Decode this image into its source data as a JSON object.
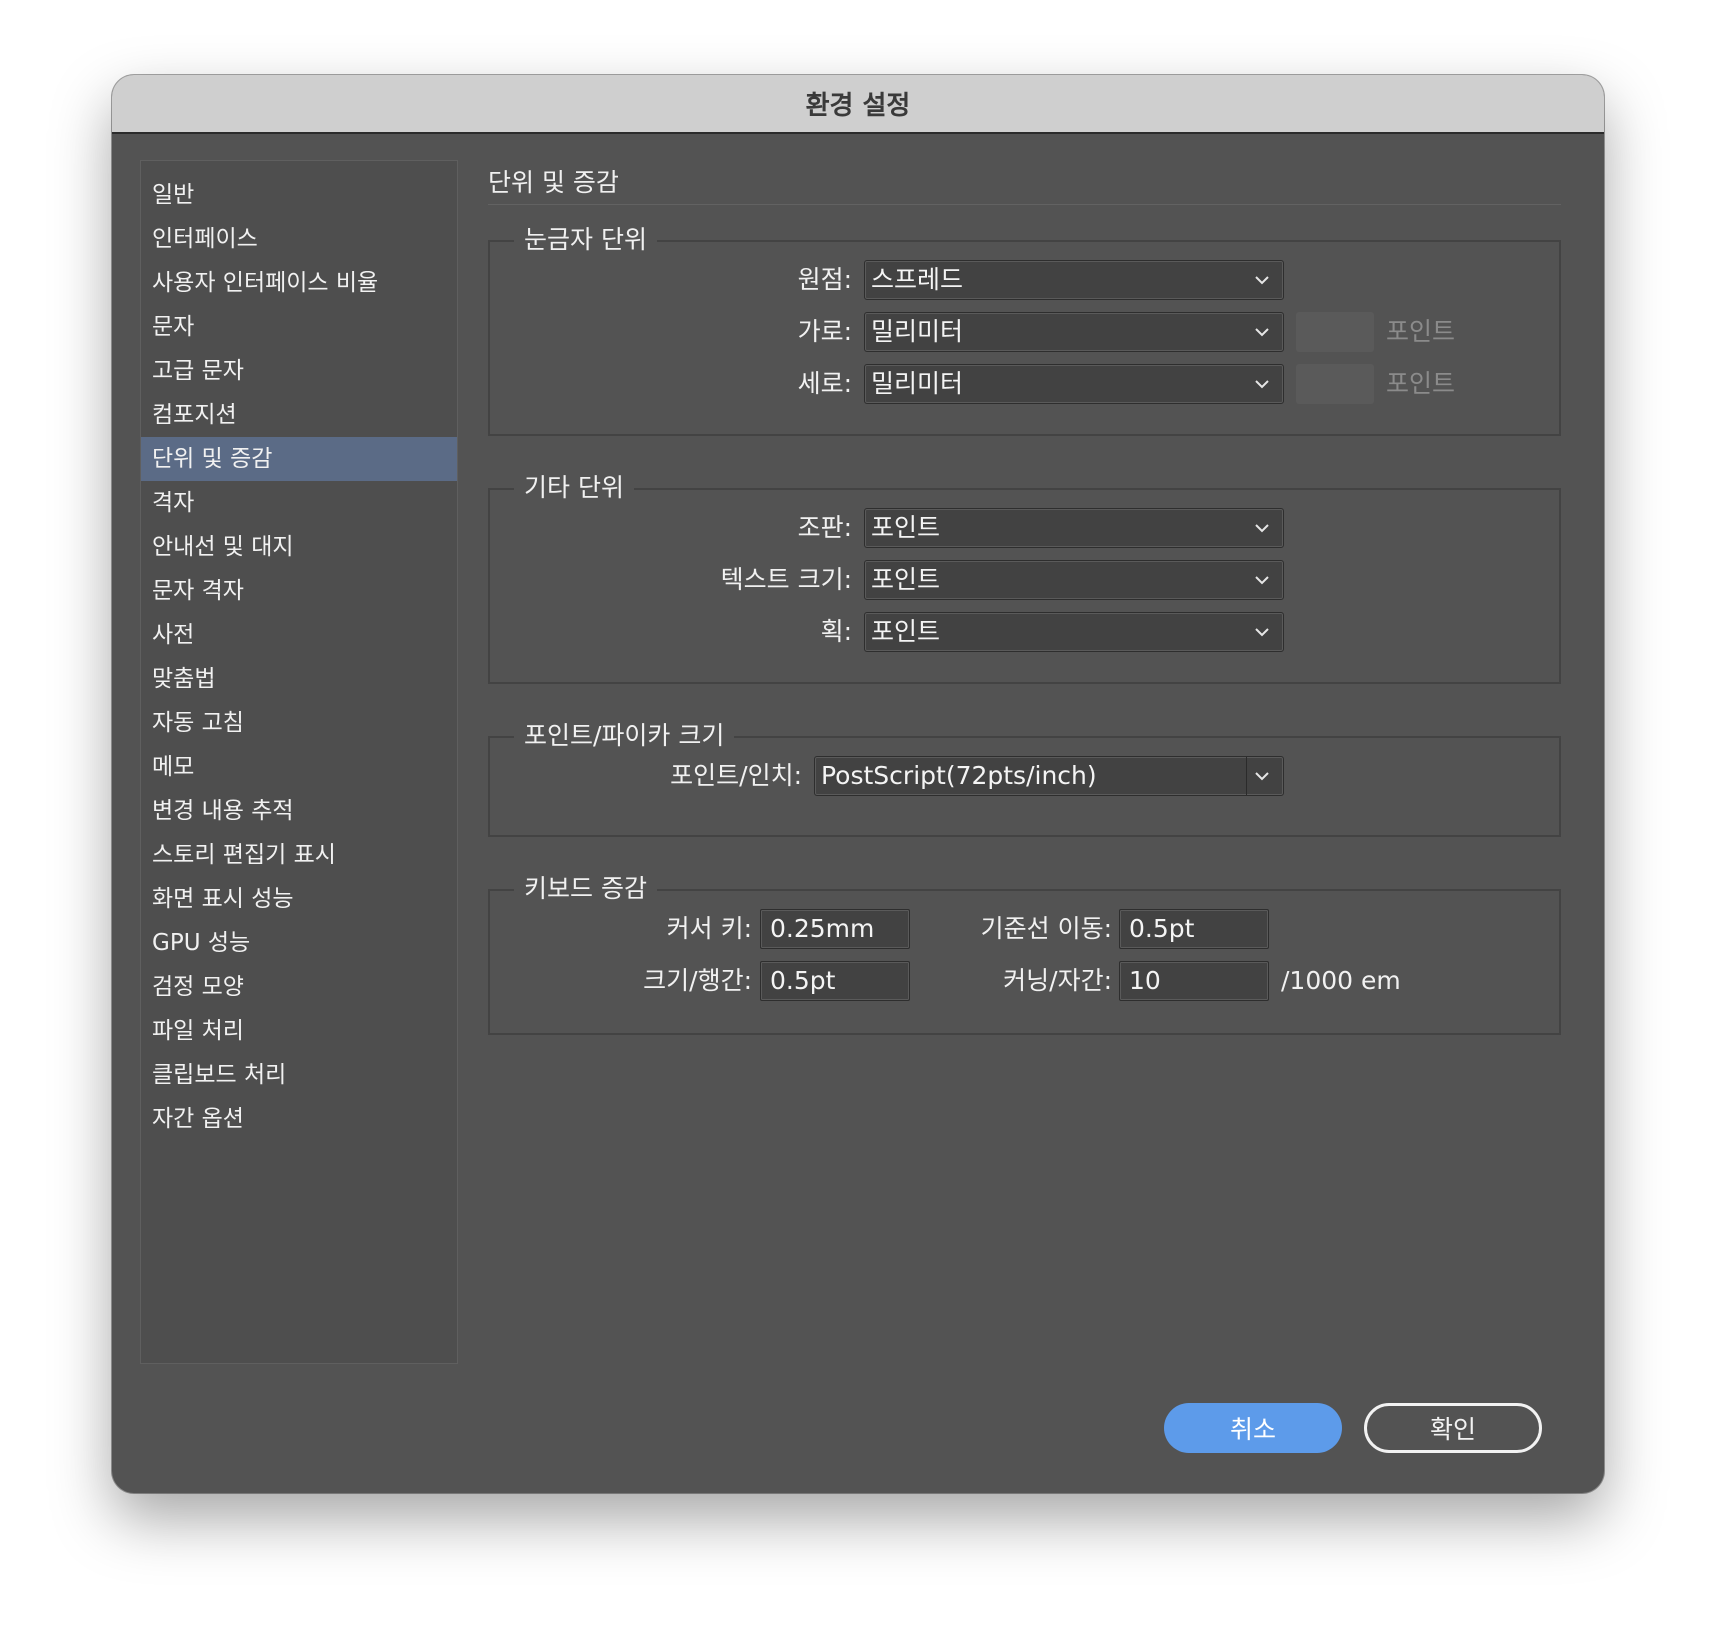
{
  "window": {
    "title": "환경 설정"
  },
  "sidebar": {
    "items": [
      {
        "label": "일반"
      },
      {
        "label": "인터페이스"
      },
      {
        "label": "사용자 인터페이스 비율"
      },
      {
        "label": "문자"
      },
      {
        "label": "고급 문자"
      },
      {
        "label": "컴포지션"
      },
      {
        "label": "단위 및 증감",
        "selected": true
      },
      {
        "label": "격자"
      },
      {
        "label": "안내선 및 대지"
      },
      {
        "label": "문자 격자"
      },
      {
        "label": "사전"
      },
      {
        "label": "맞춤법"
      },
      {
        "label": "자동 고침"
      },
      {
        "label": "메모"
      },
      {
        "label": "변경 내용 추적"
      },
      {
        "label": "스토리 편집기 표시"
      },
      {
        "label": "화면 표시 성능"
      },
      {
        "label": "GPU 성능"
      },
      {
        "label": "검정 모양"
      },
      {
        "label": "파일 처리"
      },
      {
        "label": "클립보드 처리"
      },
      {
        "label": "자간 옵션"
      }
    ]
  },
  "main": {
    "title": "단위 및 증감",
    "ruler_units": {
      "legend": "눈금자 단위",
      "origin": {
        "label": "원점:",
        "value": "스프레드"
      },
      "horizontal": {
        "label": "가로:",
        "value": "밀리미터",
        "unit": "포인트"
      },
      "vertical": {
        "label": "세로:",
        "value": "밀리미터",
        "unit": "포인트"
      }
    },
    "other_units": {
      "legend": "기타 단위",
      "composition": {
        "label": "조판:",
        "value": "포인트"
      },
      "text_size": {
        "label": "텍스트 크기:",
        "value": "포인트"
      },
      "stroke": {
        "label": "획:",
        "value": "포인트"
      }
    },
    "point_pica": {
      "legend": "포인트/파이카 크기",
      "points_inch": {
        "label": "포인트/인치:",
        "value": "PostScript(72pts/inch)"
      }
    },
    "keyboard": {
      "legend": "키보드 증감",
      "cursor_key": {
        "label": "커서 키:",
        "value": "0.25mm"
      },
      "baseline_shift": {
        "label": "기준선 이동:",
        "value": "0.5pt"
      },
      "size_leading": {
        "label": "크기/행간:",
        "value": "0.5pt"
      },
      "kerning_tracking": {
        "label": "커닝/자간:",
        "value": "10",
        "unit": "/1000 em"
      }
    }
  },
  "buttons": {
    "cancel": "취소",
    "ok": "확인"
  }
}
